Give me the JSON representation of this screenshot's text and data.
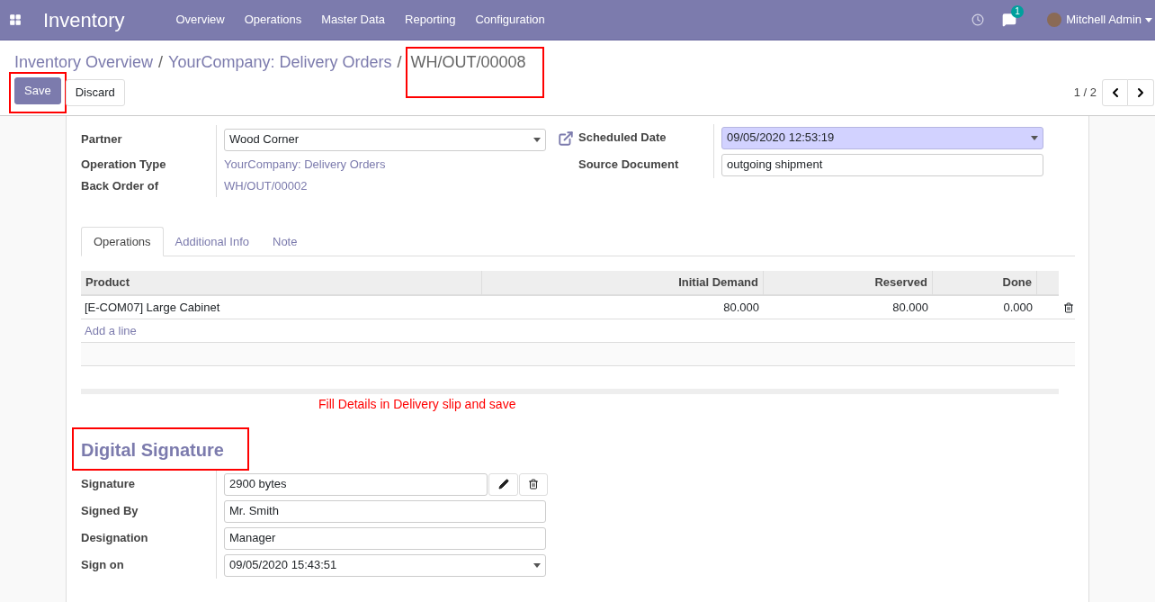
{
  "navbar": {
    "app_name": "Inventory",
    "menu": [
      "Overview",
      "Operations",
      "Master Data",
      "Reporting",
      "Configuration"
    ],
    "messages_badge": "1",
    "user": "Mitchell Admin"
  },
  "breadcrumb": {
    "links": [
      "Inventory Overview",
      "YourCompany: Delivery Orders"
    ],
    "current": "WH/OUT/00008",
    "separator": "/",
    "highlighted": true
  },
  "actions": [
    {
      "label": "Save",
      "kind": "primary",
      "highlighted": true
    },
    {
      "label": "Discard",
      "kind": "secondary",
      "highlighted": false
    }
  ],
  "pager": "1 / 2",
  "left_fields": [
    {
      "label": "Partner",
      "kind": "select",
      "value": "Wood Corner"
    },
    {
      "label": "Operation Type",
      "kind": "link",
      "value": "YourCompany: Delivery Orders"
    },
    {
      "label": "Back Order of",
      "kind": "link",
      "value": "WH/OUT/00002"
    }
  ],
  "right_fields": [
    {
      "label": "Scheduled Date",
      "kind": "select",
      "value": "09/05/2020 12:53:19",
      "focused": true
    },
    {
      "label": "Source Document",
      "kind": "input",
      "value": "outgoing shipment",
      "focused": false
    }
  ],
  "tabs": [
    {
      "label": "Operations",
      "selected": true
    },
    {
      "label": "Additional Info",
      "selected": false
    },
    {
      "label": "Note",
      "selected": false
    }
  ],
  "table": {
    "columns": [
      "Product",
      "Initial Demand",
      "Reserved",
      "Done"
    ],
    "rows": [
      {
        "cells": [
          "[E-COM07] Large Cabinet",
          "80.000",
          "80.000",
          "0.000"
        ]
      }
    ],
    "add_line": "Add a line"
  },
  "note": "Fill Details in Delivery slip and save",
  "signature_section": {
    "title": "Digital Signature",
    "highlighted": true,
    "fields": [
      {
        "label": "Signature",
        "kind": "binary",
        "value": "2900 bytes"
      },
      {
        "label": "Signed By",
        "kind": "input",
        "value": "Mr. Smith"
      },
      {
        "label": "Designation",
        "kind": "input",
        "value": "Manager"
      },
      {
        "label": "Sign on",
        "kind": "select",
        "value": "09/05/2020 15:43:51"
      }
    ]
  }
}
